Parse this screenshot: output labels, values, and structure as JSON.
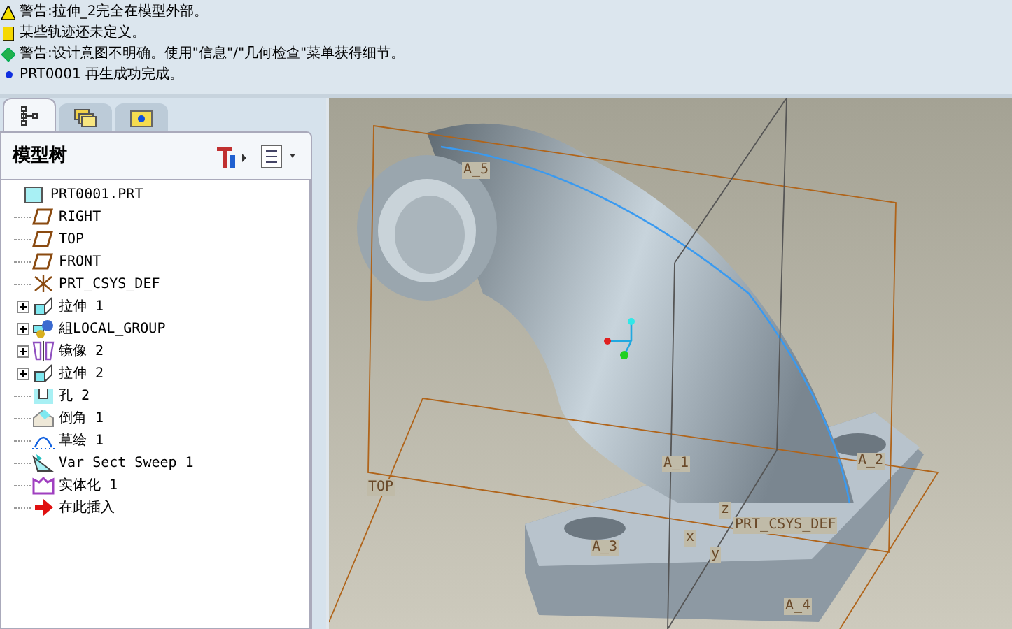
{
  "messages": [
    {
      "kind": "warning",
      "text": "警告:拉伸_2完全在模型外部。"
    },
    {
      "kind": "note",
      "text": "某些轨迹还未定义。"
    },
    {
      "kind": "caution",
      "text": "警告:设计意图不明确。使用\"信息\"/\"几何检查\"菜单获得细节。"
    },
    {
      "kind": "info",
      "text": "PRT0001 再生成功完成。"
    }
  ],
  "tabs": [
    {
      "kind": "tree",
      "selected": true
    },
    {
      "kind": "folders",
      "selected": false
    },
    {
      "kind": "favorites",
      "selected": false
    }
  ],
  "panel": {
    "title": "模型树"
  },
  "tree": [
    {
      "kind": "root",
      "label": "PRT0001.PRT",
      "expandable": false,
      "children": [
        {
          "kind": "plane",
          "label": "RIGHT",
          "expandable": false
        },
        {
          "kind": "plane",
          "label": "TOP",
          "expandable": false
        },
        {
          "kind": "plane",
          "label": "FRONT",
          "expandable": false
        },
        {
          "kind": "csys",
          "label": "PRT_CSYS_DEF",
          "expandable": false
        },
        {
          "kind": "extrude",
          "label": "拉伸 1",
          "expandable": true
        },
        {
          "kind": "group",
          "label": "組LOCAL_GROUP",
          "expandable": true
        },
        {
          "kind": "mirror",
          "label": "镜像 2",
          "expandable": true
        },
        {
          "kind": "extrude",
          "label": "拉伸 2",
          "expandable": true
        },
        {
          "kind": "hole",
          "label": "孔 2",
          "expandable": false
        },
        {
          "kind": "chamfer",
          "label": "倒角 1",
          "expandable": false
        },
        {
          "kind": "sketch",
          "label": "草绘 1",
          "expandable": false
        },
        {
          "kind": "sweep",
          "label": "Var Sect Sweep 1",
          "expandable": false
        },
        {
          "kind": "solidify",
          "label": "实体化 1",
          "expandable": false
        },
        {
          "kind": "insert",
          "label": "在此插入",
          "expandable": false
        }
      ]
    }
  ],
  "viewport": {
    "labels": [
      {
        "text": "A_5"
      },
      {
        "text": "A_1"
      },
      {
        "text": "A_2"
      },
      {
        "text": "TOP"
      },
      {
        "text": "A_3"
      },
      {
        "text": "PRT_CSYS_DEF"
      },
      {
        "text": "A_4"
      },
      {
        "text": "z"
      },
      {
        "text": "x"
      },
      {
        "text": "y"
      }
    ]
  }
}
